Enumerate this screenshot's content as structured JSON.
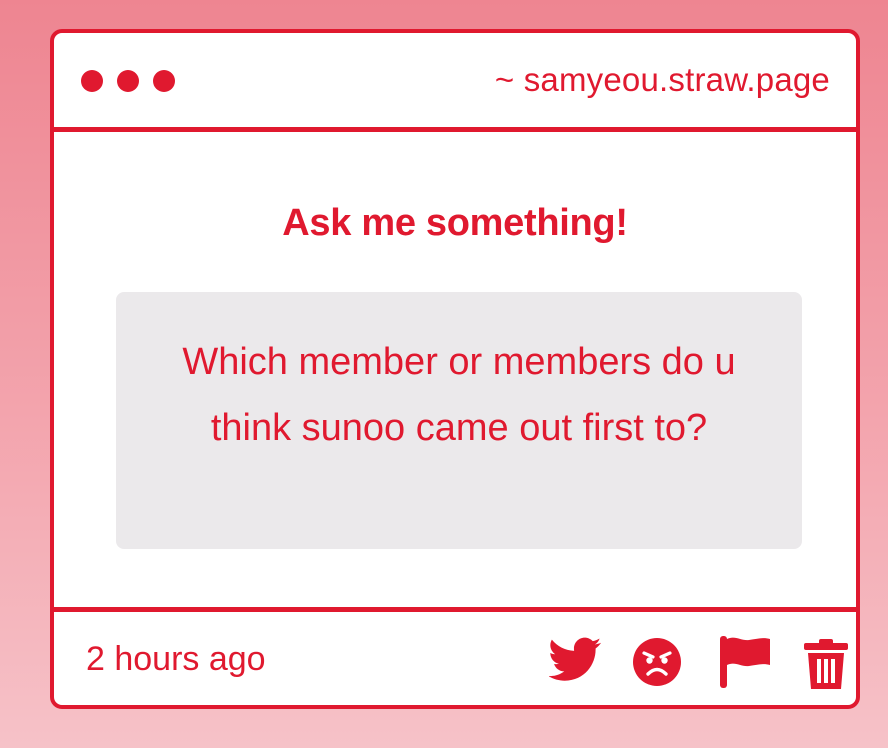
{
  "window": {
    "url": "~ samyeou.straw.page"
  },
  "main": {
    "heading": "Ask me something!",
    "question": "Which member or members do u think sunoo came out first to?"
  },
  "footer": {
    "timestamp": "2 hours ago",
    "actions": [
      {
        "icon": "twitter-icon"
      },
      {
        "icon": "angry-face-icon"
      },
      {
        "icon": "flag-icon"
      },
      {
        "icon": "trash-icon"
      }
    ]
  },
  "colors": {
    "accent": "#e0192f",
    "question_bg": "#ebe9eb",
    "page_bg_top": "#ee8591",
    "page_bg_bottom": "#f6c2c8"
  }
}
